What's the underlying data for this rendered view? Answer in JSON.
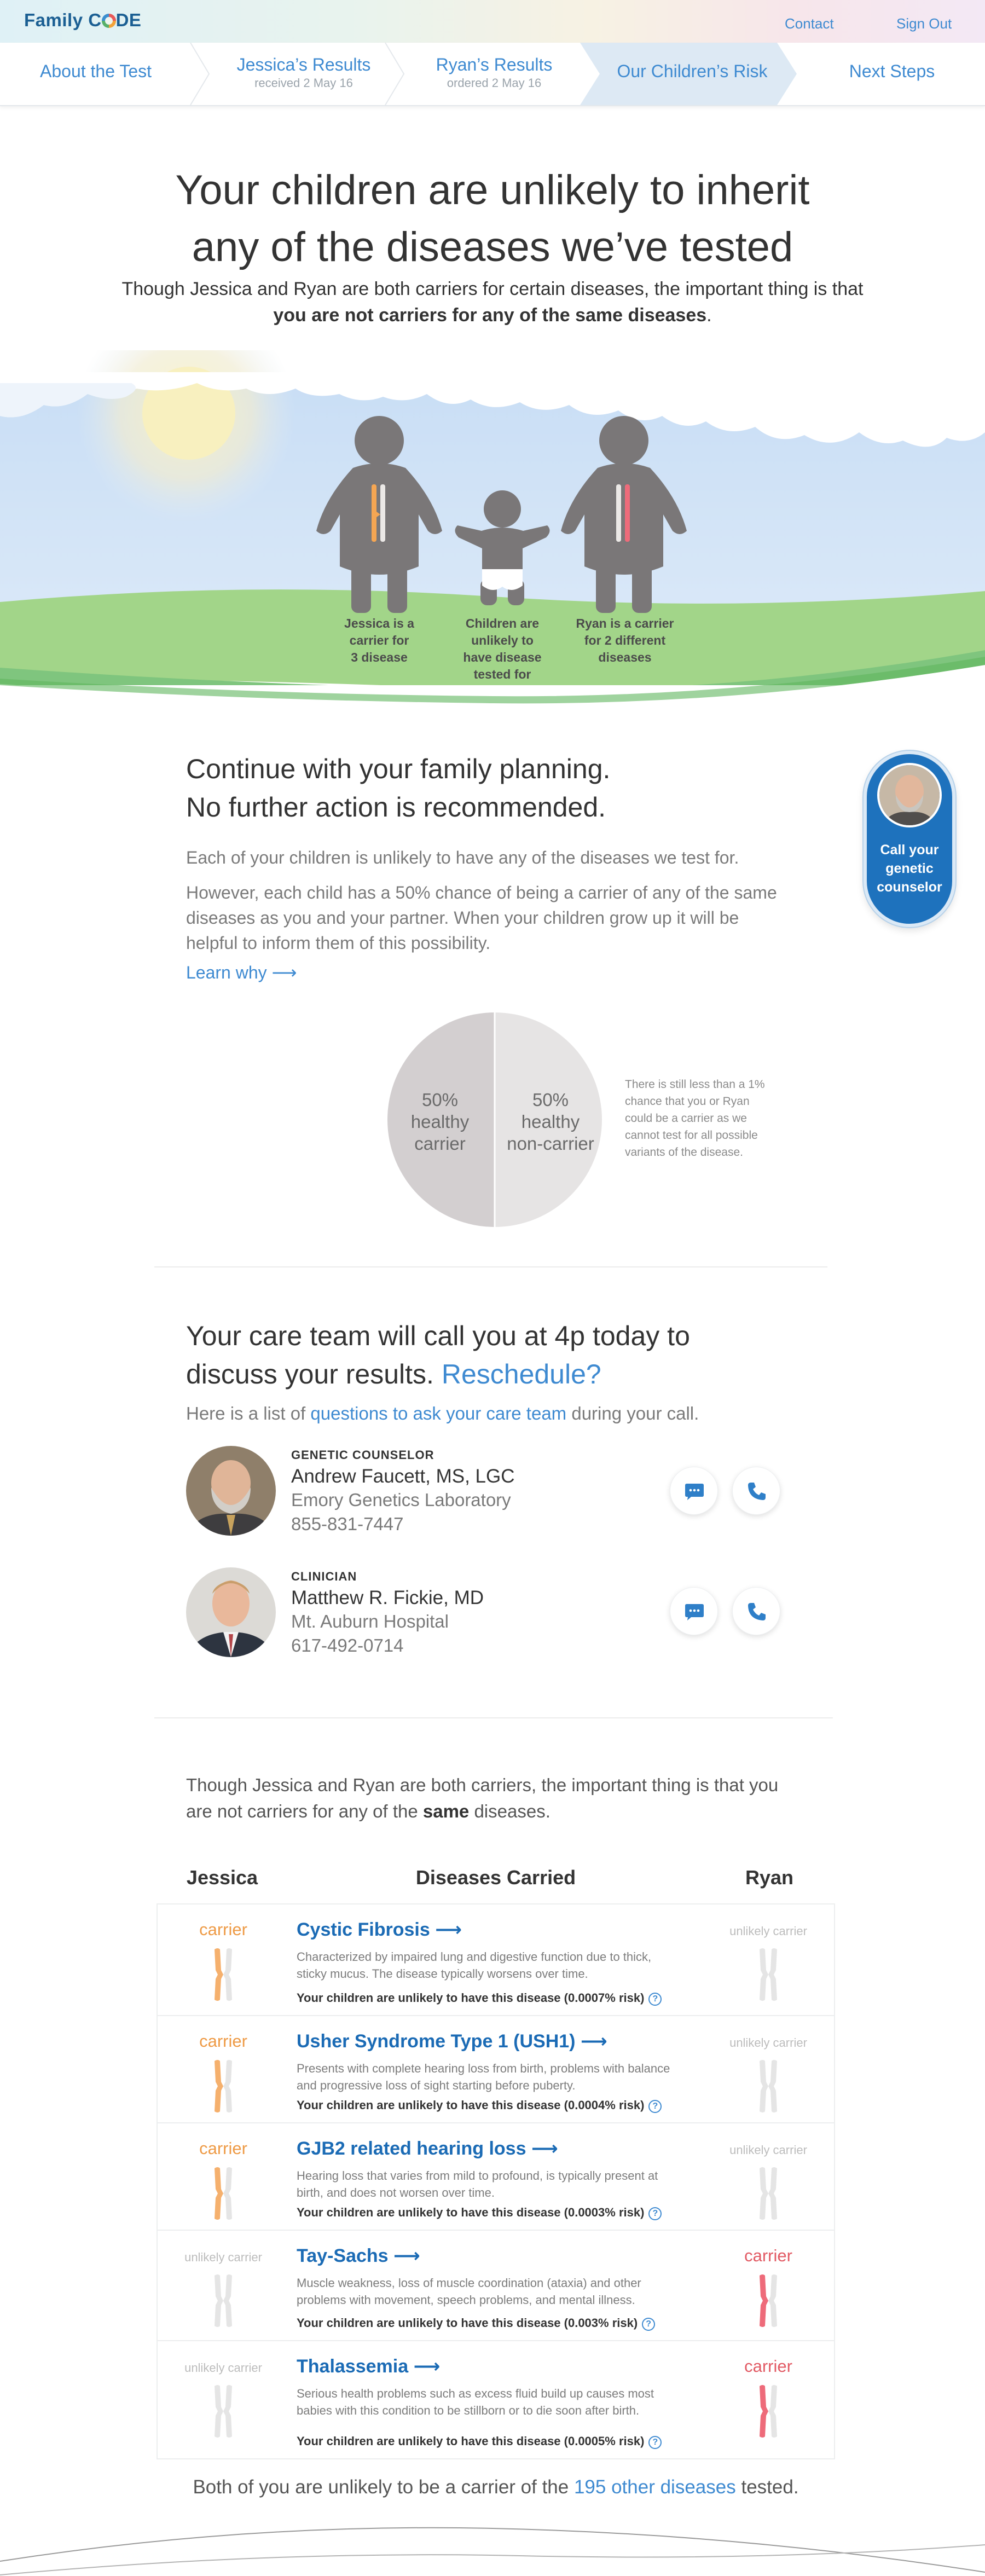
{
  "header": {
    "logo": {
      "part1": "Family",
      "part2": "C",
      "part3": "DE"
    },
    "contact_label": "Contact",
    "signout_label": "Sign Out"
  },
  "steps": [
    {
      "label": "About the Test",
      "sub": ""
    },
    {
      "label": "Jessica’s Results",
      "sub": "received 2 May 16"
    },
    {
      "label": "Ryan’s Results",
      "sub": "ordered 2 May 16"
    },
    {
      "label": "Our Children’s Risk",
      "sub": ""
    },
    {
      "label": "Next Steps",
      "sub": ""
    }
  ],
  "hero": {
    "title_line1": "Your children are unlikely to inherit",
    "title_line2": "any of the diseases we’ve tested",
    "sub_line1": "Though Jessica and Ryan are both carriers for certain diseases, the important thing is that",
    "sub_line2_bold": "you are not carriers for any of the same diseases",
    "sub_line2_end": "."
  },
  "figures": {
    "jessica_caption": [
      "Jessica is a",
      "carrier for",
      "3 disease"
    ],
    "child_caption": [
      "Children are",
      "unlikely to",
      "have disease",
      "tested for"
    ],
    "ryan_caption": [
      "Ryan is a carrier",
      "for 2 different",
      "diseases"
    ]
  },
  "colors": {
    "accent": "#3e8ad1",
    "brand": "#1b5f93",
    "carrier_orange": "#ee9a45",
    "carrier_red": "#e25a64",
    "figure_gray": "#7a7778",
    "grass": "#a2d589",
    "sky": "#cfe3f7"
  },
  "continue": {
    "title_line1": "Continue with your family planning.",
    "title_line2": "No further action is recommended.",
    "p1": "Each of your children is unlikely to have any of the diseases we test for.",
    "p2_line1": "However, each child has a 50% chance of being a carrier of any of the same",
    "p2_line2": "diseases as you and your partner. When your children grow up it will be",
    "p2_line3": "helpful to inform them of this possibility.",
    "learn_why": "Learn why",
    "counselor_button": [
      "Call your",
      "genetic",
      "counselor"
    ]
  },
  "pie": {
    "left_pct": "50%",
    "left_l1": "healthy",
    "left_l2": "carrier",
    "right_pct": "50%",
    "right_l1": "healthy",
    "right_l2": "non-carrier",
    "note": [
      "There is still less than a 1%",
      "chance that you or Ryan",
      "could be a carrier as we",
      "cannot test for all possible",
      "variants of the disease."
    ]
  },
  "chart_data": {
    "type": "pie",
    "categories": [
      "healthy carrier",
      "healthy non-carrier"
    ],
    "values": [
      50,
      50
    ],
    "colors": [
      "#d3cfd0",
      "#e6e4e4"
    ]
  },
  "care": {
    "title_line1": "Your care team will call you at 4p today to",
    "title_line2_start": "discuss your results.",
    "reschedule": "Reschedule?",
    "sub_start": "Here is a list of",
    "sub_link": "questions to ask your care team",
    "sub_end": "during your call.",
    "people": [
      {
        "role": "GENETIC COUNSELOR",
        "name": "Andrew Faucett, MS, LGC",
        "org": "Emory Genetics Laboratory",
        "phone": "855-831-7447"
      },
      {
        "role": "CLINICIAN",
        "name": "Matthew R. Fickie, MD",
        "org": "Mt. Auburn Hospital",
        "phone": "617-492-0714"
      }
    ]
  },
  "diseases": {
    "intro_line1": "Though Jessica and Ryan are both carriers, the important thing is that you",
    "intro_line2_start": "are not carriers for any of the",
    "intro_bold": "same",
    "intro_line2_end": "diseases.",
    "col_jessica": "Jessica",
    "col_diseases": "Diseases Carried",
    "col_ryan": "Ryan",
    "carrier_label": "carrier",
    "unlikely_label": "unlikely carrier",
    "rows": [
      {
        "name": "Cystic Fibrosis",
        "desc": [
          "Characterized by impaired lung and digestive function due to thick,",
          "sticky mucus. The disease typically worsens over time."
        ],
        "risk": "Your children are unlikely to have this disease (0.0007% risk)",
        "carrier": "jessica"
      },
      {
        "name": "Usher Syndrome Type 1 (USH1)",
        "desc": [
          "Presents with complete hearing loss from birth, problems with balance",
          "and progressive loss of sight starting before puberty."
        ],
        "risk": "Your children are unlikely to have this disease (0.0004% risk)",
        "carrier": "jessica"
      },
      {
        "name": "GJB2 related hearing loss",
        "desc": [
          "Hearing loss that varies from mild to profound, is typically present at",
          "birth, and does not worsen over time."
        ],
        "risk": "Your children are unlikely to have this disease (0.0003% risk)",
        "carrier": "jessica"
      },
      {
        "name": "Tay-Sachs",
        "desc": [
          "Muscle weakness, loss of muscle coordination (ataxia) and other",
          "problems with movement, speech problems, and mental illness."
        ],
        "risk": "Your children are unlikely to have this disease (0.003% risk)",
        "carrier": "ryan"
      },
      {
        "name": "Thalassemia",
        "desc": [
          "Serious health problems such as excess fluid build up causes most",
          "babies with this condition to be stillborn or to die soon after birth."
        ],
        "risk": "Your children are unlikely to have this disease (0.0005% risk)",
        "carrier": "ryan"
      }
    ],
    "footer_start": "Both of you are unlikely to be a carrier of the",
    "footer_link": "195 other diseases",
    "footer_end": "tested."
  }
}
